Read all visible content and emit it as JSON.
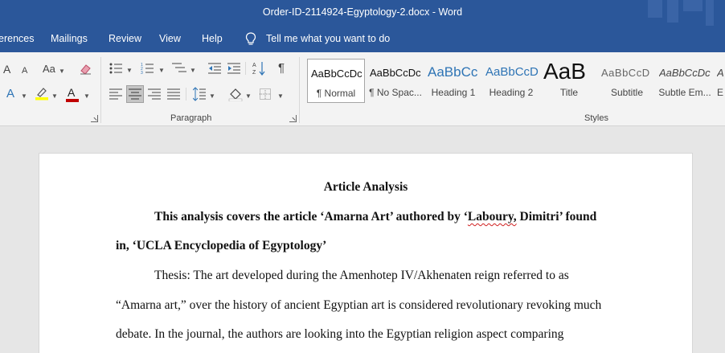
{
  "window": {
    "title": "Order-ID-2114924-Egyptology-2.docx  -  Word"
  },
  "menu": {
    "tabs": [
      "erences",
      "Mailings",
      "Review",
      "View",
      "Help"
    ],
    "tell_me": "Tell me what you want to do"
  },
  "ribbon": {
    "font_group": {
      "grow_icon": "A",
      "shrink_icon": "A",
      "case_icon": "Aa",
      "effects_icon": "A",
      "font_color_icon": "A"
    },
    "paragraph_group": {
      "label": "Paragraph"
    },
    "styles_group": {
      "label": "Styles",
      "tiles": [
        {
          "sample": "AaBbCcDc",
          "label": "¶ Normal"
        },
        {
          "sample": "AaBbCcDc",
          "label": "¶ No Spac..."
        },
        {
          "sample": "AaBbCc",
          "label": "Heading 1"
        },
        {
          "sample": "AaBbCcD",
          "label": "Heading 2"
        },
        {
          "sample": "AaB",
          "label": "Title"
        },
        {
          "sample": "AaBbCcD",
          "label": "Subtitle"
        },
        {
          "sample": "AaBbCcDc",
          "label": "Subtle Em..."
        },
        {
          "sample": "A",
          "label": "E"
        }
      ]
    }
  },
  "document": {
    "heading": "Article Analysis",
    "bold_line_1_pre": "This analysis covers the article ‘Amarna Art’ authored by ‘",
    "bold_line_1_squiggle": "Laboury,",
    "bold_line_1_post": " Dimitri’ found",
    "bold_line_2": "in, ‘UCLA Encyclopedia of Egyptology’",
    "body_line_1": "Thesis: The art developed during the Amenhotep IV/Akhenaten reign referred to as",
    "body_line_2": "“Amarna art,” over the history of ancient Egyptian art is considered revolutionary revoking much",
    "body_line_3": "debate. In the journal, the authors are looking into the Egyptian religion aspect comparing"
  },
  "colors": {
    "word_blue": "#2b579a",
    "font_color_red": "#c00000",
    "highlight_yellow": "#ffff00",
    "heading_blue": "#2e74b5"
  }
}
